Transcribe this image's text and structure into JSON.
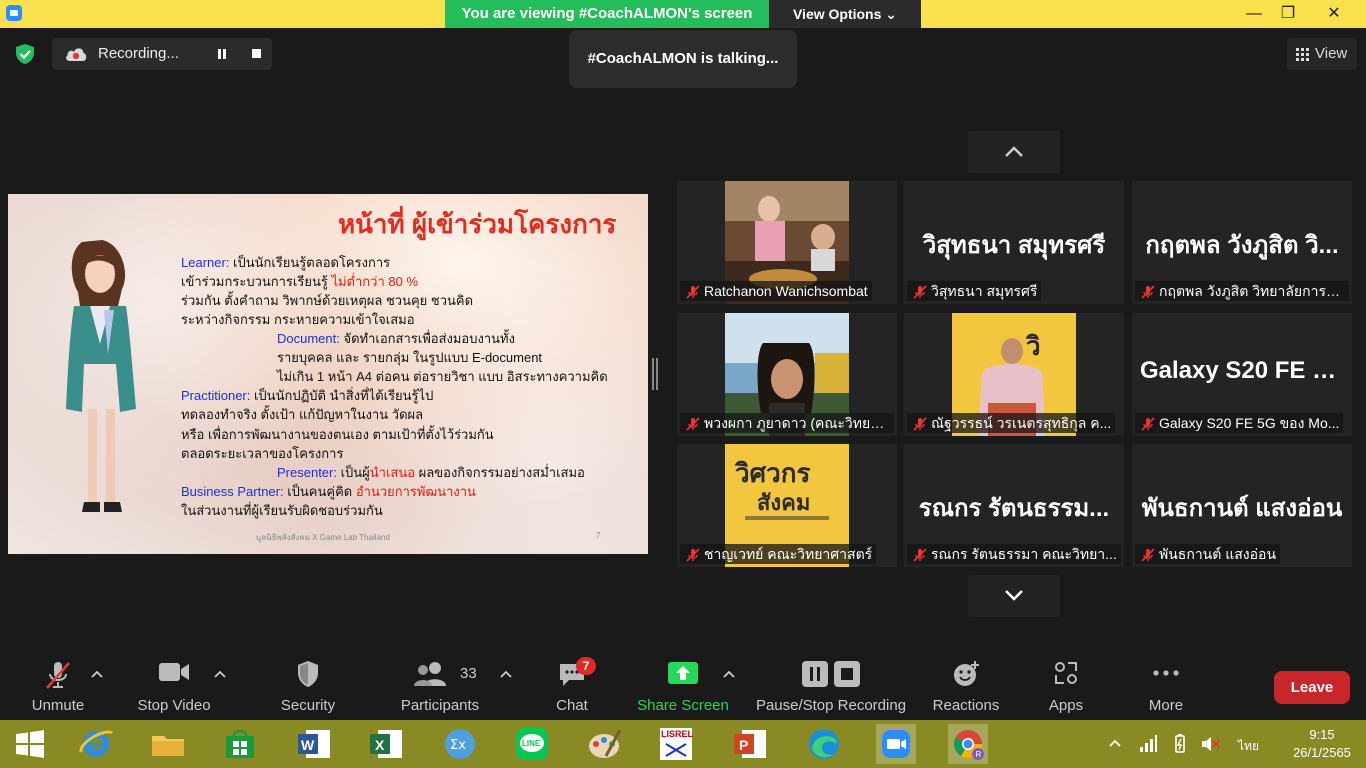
{
  "topbar": {
    "viewing_banner": "You are viewing #CoachALMON's screen",
    "view_options": "View Options ⌄",
    "minimize": "—",
    "restore": "❐",
    "close": "✕"
  },
  "status": {
    "recording_label": "Recording...",
    "talking": "#CoachALMON is talking...",
    "view_label": "View"
  },
  "slide": {
    "title": "หน้าที่ ผู้เข้าร่วมโครงการ",
    "lines": {
      "l1_key": "Learner:",
      "l1_text": " เป็นนักเรียนรู้ตลอดโครงการ",
      "l2_text": "เข้าร่วมกระบวนการเรียนรู้ ",
      "l2_red": "ไม่ต่ำกว่า 80 %",
      "l3_text": "ร่วมกัน ตั้งคำถาม วิพากษ์ด้วยเหตุผล ชวนคุย ชวนคิด",
      "l4_text": "ระหว่างกิจกรรม กระหายความเข้าใจเสมอ",
      "l5_key": "Document:",
      "l5_text": " จัดทำเอกสารเพื่อส่งมอบงานทั้ง",
      "l6_text": "รายบุคคล และ รายกลุ่ม ในรูปแบบ E-document",
      "l7_red": "ไม่เกิน 1 หน้า A4 ต่อคน ต่อรายวิชา แบบ อิสระทางความคิด",
      "l8_key": "Practitioner:",
      "l8_text": " เป็นนักปฏิบัติ นำสิ่งที่ได้เรียนรู้ไป",
      "l9_red": "ทดลองทำจริง ตั้งเป้า แก้ปัญหาในงาน วัดผล",
      "l10_text": "หรือ เพื่อการพัฒนางานของตนเอง ตามเป้าที่ตั้งไว้ร่วมกัน",
      "l11_text": "ตลอดระยะเวลาของโครงการ",
      "l12_key": "Presenter:",
      "l12_text": " เป็นผู้",
      "l12_red": "นำเสนอ",
      "l12_text2": " ผลของกิจกรรมอย่างสม่ำเสมอ",
      "l13_key": "Business Partner:",
      "l13_text": " เป็นคนคู่คิด ",
      "l13_red": "อำนวยการพัฒนางาน",
      "l14_text": "ในส่วนงานที่ผู้เรียนรับผิดชอบร่วมกัน"
    },
    "footer": "มูลนิธิพลังสังคม X Game Lab Thailand",
    "page": "7"
  },
  "gallery": {
    "tiles": [
      {
        "label": "Ratchanon Wanichsombat",
        "big": ""
      },
      {
        "label": "วิสุทธนา สมุทรศรี",
        "big": "วิสุทธนา สมุทรศรี"
      },
      {
        "label": "กฤตพล วังภูสิต วิทยาลัยการฝึ...",
        "big": "กฤตพล วังภูสิต วิ..."
      },
      {
        "label": "พวงผกา ภูยาดาว (คณะวิทยาศ...",
        "big": ""
      },
      {
        "label": "ณัฐวรรธน์ วรเนตรสุทธิกุล ค...",
        "big": ""
      },
      {
        "label": "Galaxy S20 FE 5G ของ Mo...",
        "big": "Galaxy S20 FE 5..."
      },
      {
        "label": "ชาญเวทย์ คณะวิทยาศาสตร์",
        "big": ""
      },
      {
        "label": "รณกร รัตนธรรมา คณะวิทยา...",
        "big": "รณกร รัตนธรรม..."
      },
      {
        "label": "พันธกานต์ แสงอ่อน",
        "big": "พันธกานต์ แสงอ่อน"
      }
    ]
  },
  "toolbar": {
    "unmute": "Unmute",
    "stop_video": "Stop Video",
    "security": "Security",
    "participants": "Participants",
    "participants_count": "33",
    "chat": "Chat",
    "chat_badge": "7",
    "share_screen": "Share Screen",
    "pause_stop_recording": "Pause/Stop Recording",
    "reactions": "Reactions",
    "apps": "Apps",
    "more": "More",
    "leave": "Leave"
  },
  "taskbar": {
    "lang": "ไทย",
    "time": "9:15",
    "date": "26/1/2565"
  },
  "colors": {
    "zoom_yellow": "#f8e14d",
    "banner_green": "#23bd5b",
    "leave_red": "#c9262c",
    "share_green": "#23d959",
    "slide_title_red": "#e32b1f"
  }
}
